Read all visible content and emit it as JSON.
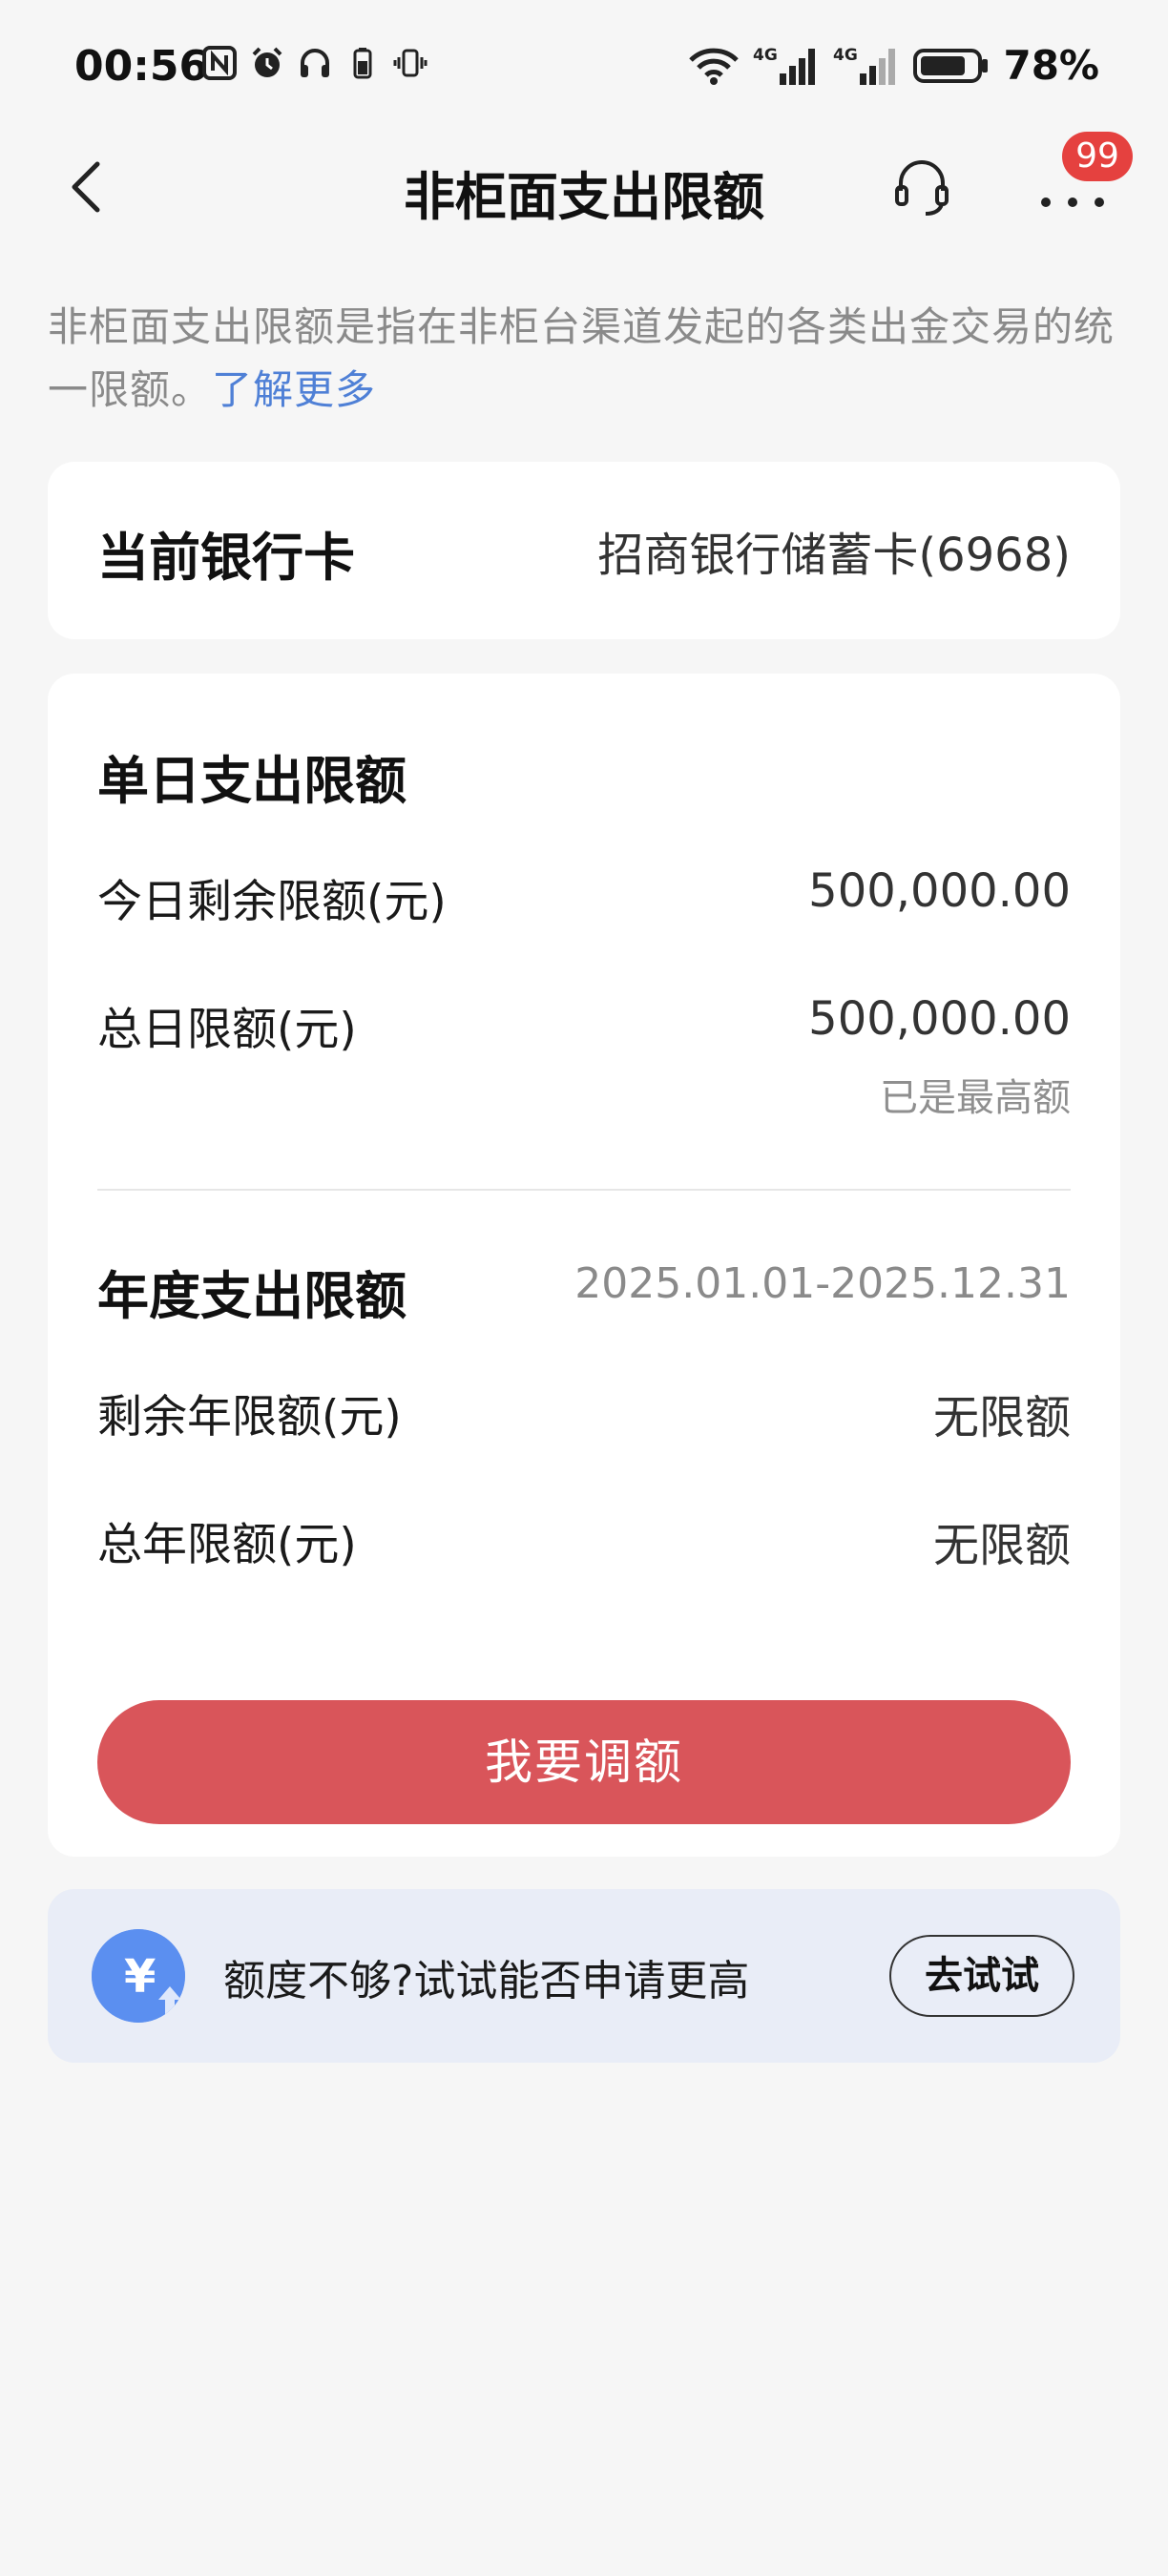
{
  "status_bar": {
    "time": "00:56",
    "left_icons": [
      "nfc-icon",
      "alarm-icon",
      "headphones-icon",
      "battery-small-icon",
      "vibrate-icon"
    ],
    "right_icons": [
      "wifi-icon",
      "signal-4g-1-icon",
      "signal-4g-2-icon",
      "battery-icon"
    ],
    "network_1": "4G",
    "network_2": "4G",
    "battery_percent": "78%"
  },
  "nav": {
    "title": "非柜面支出限额",
    "badge": "99",
    "icons": [
      "back-icon",
      "customer-service-icon",
      "more-icon"
    ]
  },
  "intro": {
    "text": "非柜面支出限额是指在非柜台渠道发起的各类出金交易的统一限额。",
    "link": "了解更多"
  },
  "current_card": {
    "label": "当前银行卡",
    "value": "招商银行储蓄卡(6968)"
  },
  "daily": {
    "title": "单日支出限额",
    "remaining_label": "今日剩余限额(元)",
    "remaining_value": "500,000.00",
    "total_label": "总日限额(元)",
    "total_value": "500,000.00",
    "total_note": "已是最高额"
  },
  "annual": {
    "title": "年度支出限额",
    "date_range": "2025.01.01-2025.12.31",
    "remaining_label": "剩余年限额(元)",
    "remaining_value": "无限额",
    "total_label": "总年限额(元)",
    "total_value": "无限额"
  },
  "adjust_button": "我要调额",
  "promo": {
    "icon": "yuan-up-icon",
    "icon_symbol": "¥",
    "text": "额度不够?试试能否申请更高",
    "button": "去试试"
  },
  "colors": {
    "accent_red": "#d9555a",
    "link_blue": "#4f80d6",
    "promo_bg": "#e9edf7",
    "badge_red": "#e5413f"
  }
}
